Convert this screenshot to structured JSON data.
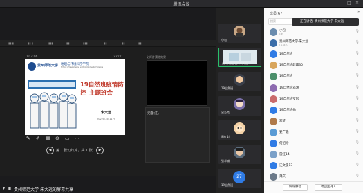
{
  "window": {
    "title": "腾讯会议",
    "controls": [
      "—",
      "□",
      "✕"
    ]
  },
  "presentation": {
    "time_elapsed": "0:07:06",
    "time_total": "22:00",
    "notes_header": "幻灯片预览效果",
    "notes_text": "无备注。",
    "nav_text": "第 1 张幻灯片，共 1 张",
    "slide": {
      "university": "贵州师范大学",
      "department": "地理与环境科学学院",
      "department_en": "School of Geography and Environmental Science",
      "title_line1": "19自然班疫情防控",
      "title_line2": "主题班会",
      "author": "朱大远",
      "date": "2022年3月11日"
    }
  },
  "presenter_bar": {
    "label": "贵州师范大学-朱大远的屏幕共享"
  },
  "video_tiles": [
    {
      "name": "小包",
      "type": "avatar",
      "active": false
    },
    {
      "name": "贵州师范大学-朱大远",
      "type": "avatar",
      "active": true
    },
    {
      "name": "19自然班",
      "type": "avatar",
      "active": false
    },
    {
      "name": "吕沁尧",
      "type": "avatar",
      "active": false
    },
    {
      "name": "雷红14",
      "type": "avatar",
      "active": false
    },
    {
      "name": "张华铖",
      "type": "avatar",
      "active": false
    },
    {
      "name": "19自然班",
      "type": "number",
      "number": "27",
      "active": false
    }
  ],
  "members": {
    "title": "成员(67)",
    "search_placeholder": "搜索",
    "speaking_tip": "正在讲话: 贵州师范大学-朱大远",
    "list": [
      {
        "name": "小包",
        "sub": "(我)"
      },
      {
        "name": "贵州师范大学-朱大远",
        "sub": "(主持人)"
      },
      {
        "name": "19自然班",
        "sub": ""
      },
      {
        "name": "19自然班赵霖30",
        "sub": ""
      },
      {
        "name": "19自然班",
        "sub": ""
      },
      {
        "name": "19自然班邓湘",
        "sub": ""
      },
      {
        "name": "19自然班罗影",
        "sub": ""
      },
      {
        "name": "19自然班杨",
        "sub": ""
      },
      {
        "name": "邓梦",
        "sub": ""
      },
      {
        "name": "安广艳",
        "sub": ""
      },
      {
        "name": "何招珍",
        "sub": ""
      },
      {
        "name": "雷红14",
        "sub": ""
      },
      {
        "name": "江文俊13",
        "sub": ""
      },
      {
        "name": "薄庆",
        "sub": ""
      }
    ],
    "mute_all": "解除静音",
    "request_host": "收回主持人"
  }
}
